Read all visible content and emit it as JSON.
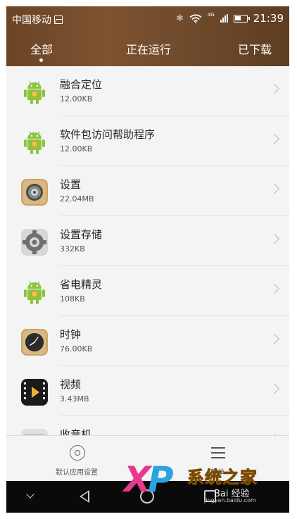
{
  "status_bar": {
    "carrier": "中国移动",
    "network": "4G",
    "time": "21:39"
  },
  "tabs": [
    {
      "label": "全部",
      "selected": true
    },
    {
      "label": "正在运行",
      "selected": false
    },
    {
      "label": "已下载",
      "selected": false
    }
  ],
  "apps": [
    {
      "name": "融合定位",
      "size": "12.00KB",
      "icon": "android-icon"
    },
    {
      "name": "软件包访问帮助程序",
      "size": "12.00KB",
      "icon": "android-icon"
    },
    {
      "name": "设置",
      "size": "22.04MB",
      "icon": "settings-icon"
    },
    {
      "name": "设置存储",
      "size": "332KB",
      "icon": "settings-storage-icon"
    },
    {
      "name": "省电精灵",
      "size": "108KB",
      "icon": "android-icon"
    },
    {
      "name": "时钟",
      "size": "76.00KB",
      "icon": "clock-icon"
    },
    {
      "name": "视频",
      "size": "3.43MB",
      "icon": "video-icon"
    },
    {
      "name": "收音机",
      "size": "",
      "icon": "radio-icon"
    }
  ],
  "action_bar": {
    "default_apps_label": "默认应用设置",
    "menu_label": "菜单"
  },
  "watermark": {
    "brand_x": "X",
    "brand_p": "P",
    "brand_cn": "系统之家",
    "baidu": "Bai 经验",
    "url": "jingyan.baidu.com"
  },
  "colors": {
    "header": "#7d5230",
    "android_green": "#8cc43f",
    "list_bg": "#f4f4f4"
  }
}
